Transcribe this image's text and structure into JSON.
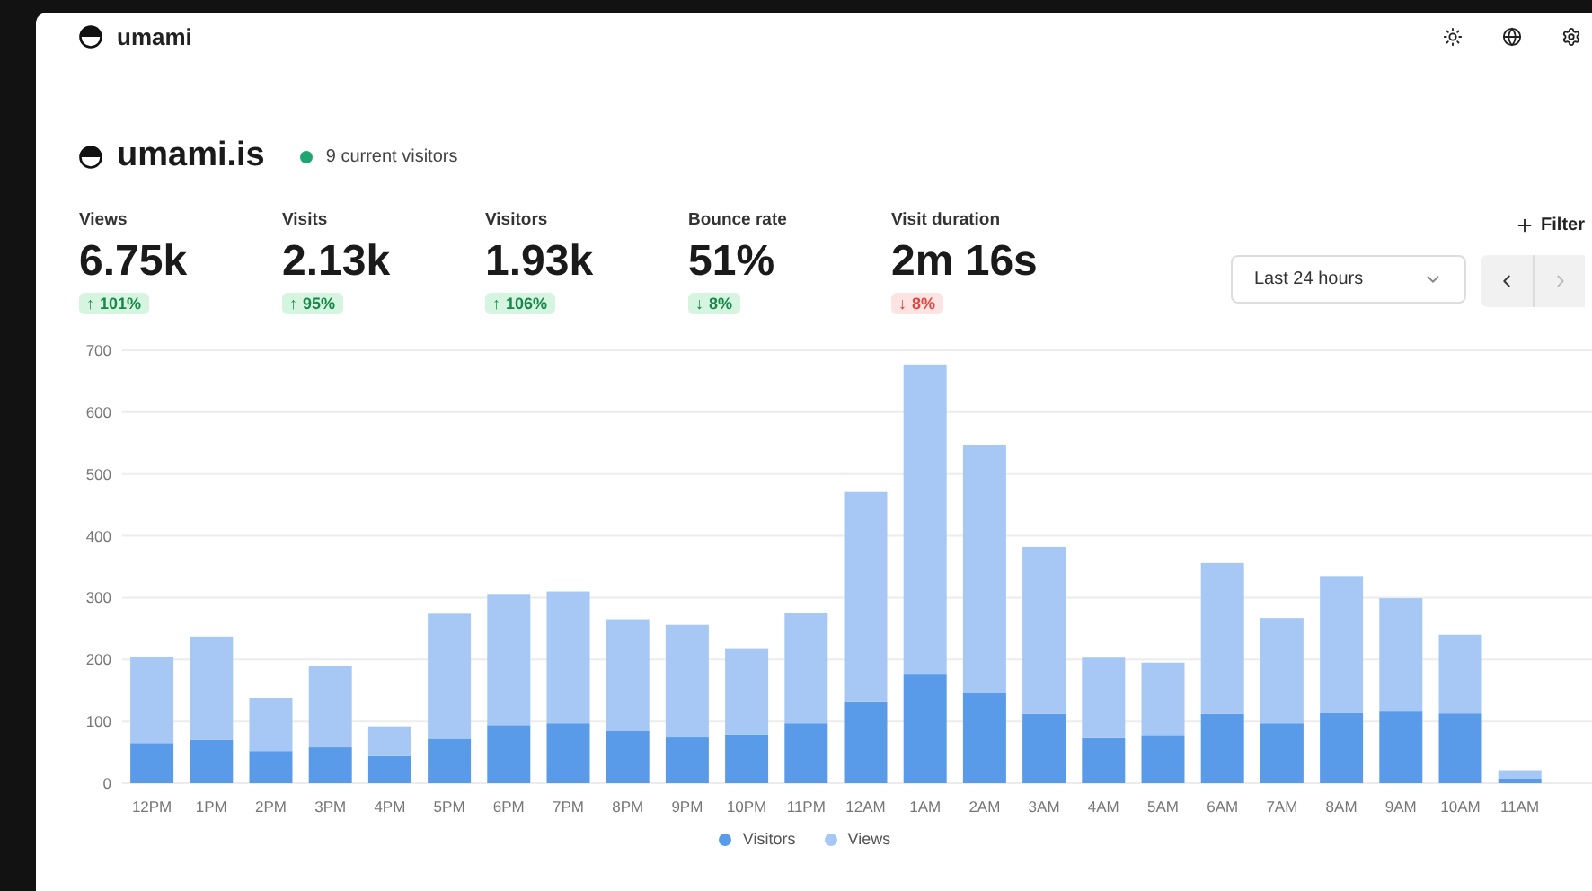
{
  "brand": {
    "name": "umami"
  },
  "site": {
    "name": "umami.is",
    "live": "9 current visitors"
  },
  "metrics": [
    {
      "label": "Views",
      "value": "6.75k",
      "change": "101%",
      "trend": "↑",
      "good": true
    },
    {
      "label": "Visits",
      "value": "2.13k",
      "change": "95%",
      "trend": "↑",
      "good": true
    },
    {
      "label": "Visitors",
      "value": "1.93k",
      "change": "106%",
      "trend": "↑",
      "good": true
    },
    {
      "label": "Bounce rate",
      "value": "51%",
      "change": "8%",
      "trend": "↓",
      "good": true
    },
    {
      "label": "Visit duration",
      "value": "2m 16s",
      "change": "8%",
      "trend": "↓",
      "good": false
    }
  ],
  "filter": {
    "label": "Filter"
  },
  "date_range": {
    "value": "Last 24 hours"
  },
  "chart": {
    "chart_data": {
      "type": "bar",
      "stacked": true,
      "grid": true,
      "categories": [
        "12PM",
        "1PM",
        "2PM",
        "3PM",
        "4PM",
        "5PM",
        "6PM",
        "7PM",
        "8PM",
        "9PM",
        "10PM",
        "11PM",
        "12AM",
        "1AM",
        "2AM",
        "3AM",
        "4AM",
        "5AM",
        "6AM",
        "7AM",
        "8AM",
        "9AM",
        "10AM",
        "11AM"
      ],
      "ylim": [
        0,
        700
      ],
      "yticks": [
        0,
        100,
        200,
        300,
        400,
        500,
        600,
        700
      ],
      "series": [
        {
          "name": "Visitors",
          "color": "#5a9be9",
          "values": [
            65,
            70,
            52,
            58,
            44,
            72,
            94,
            97,
            85,
            74,
            79,
            97,
            131,
            177,
            146,
            112,
            73,
            78,
            112,
            97,
            114,
            116,
            113,
            8
          ]
        },
        {
          "name": "Views",
          "color": "#a7c8f5",
          "values": [
            139,
            167,
            86,
            131,
            48,
            202,
            212,
            213,
            180,
            182,
            138,
            179,
            340,
            500,
            401,
            270,
            130,
            117,
            244,
            170,
            221,
            183,
            127,
            13
          ]
        }
      ]
    }
  }
}
